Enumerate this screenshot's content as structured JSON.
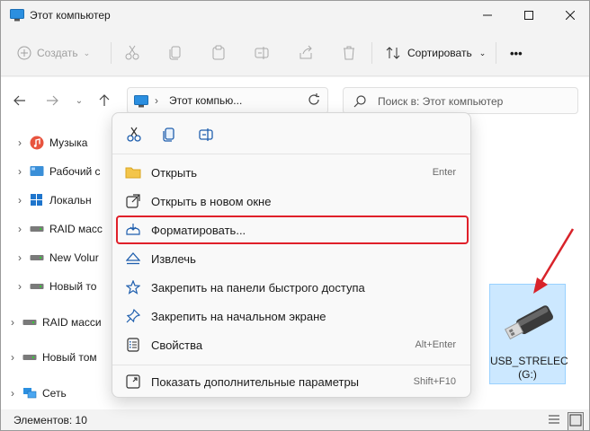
{
  "window": {
    "title": "Этот компьютер"
  },
  "commandbar": {
    "create_label": "Создать",
    "sort_label": "Сортировать",
    "more_label": "•••"
  },
  "address": {
    "crumb": "Этот компью...",
    "search_placeholder": "Поиск в: Этот компьютер"
  },
  "navpane": {
    "items": [
      {
        "label": "Музыка",
        "icon": "music-icon"
      },
      {
        "label": "Рабочий с",
        "icon": "desktop-icon"
      },
      {
        "label": "Локальн",
        "icon": "local-disk-icon"
      },
      {
        "label": "RAID масс",
        "icon": "drive-icon"
      },
      {
        "label": "New Volur",
        "icon": "drive-icon"
      },
      {
        "label": "Новый то",
        "icon": "drive-icon"
      },
      {
        "label": "RAID масси",
        "icon": "drive-icon"
      },
      {
        "label": "Новый том",
        "icon": "drive-icon"
      },
      {
        "label": "Сеть",
        "icon": "network-icon"
      }
    ]
  },
  "context_menu": {
    "items": [
      {
        "label": "Открыть",
        "shortcut": "Enter",
        "icon": "folder-open-icon"
      },
      {
        "label": "Открыть в новом окне",
        "shortcut": "",
        "icon": "open-new-window-icon"
      },
      {
        "label": "Форматировать...",
        "shortcut": "",
        "icon": "format-icon",
        "highlighted": true
      },
      {
        "label": "Извлечь",
        "shortcut": "",
        "icon": "eject-icon"
      },
      {
        "label": "Закрепить на панели быстрого доступа",
        "shortcut": "",
        "icon": "pin-star-icon"
      },
      {
        "label": "Закрепить на начальном экране",
        "shortcut": "",
        "icon": "pin-icon"
      },
      {
        "label": "Свойства",
        "shortcut": "Alt+Enter",
        "icon": "properties-icon"
      }
    ],
    "more_item": {
      "label": "Показать дополнительные параметры",
      "shortcut": "Shift+F10",
      "icon": "expand-icon"
    }
  },
  "drive": {
    "name_line1": "USB_STRELEC",
    "name_line2": "(G:)"
  },
  "statusbar": {
    "count": "Элементов: 10"
  },
  "colors": {
    "accent": "#0067c0",
    "selection": "#cce8ff",
    "highlight_box": "#e0202a",
    "annotation_arrow": "#d8232a"
  }
}
